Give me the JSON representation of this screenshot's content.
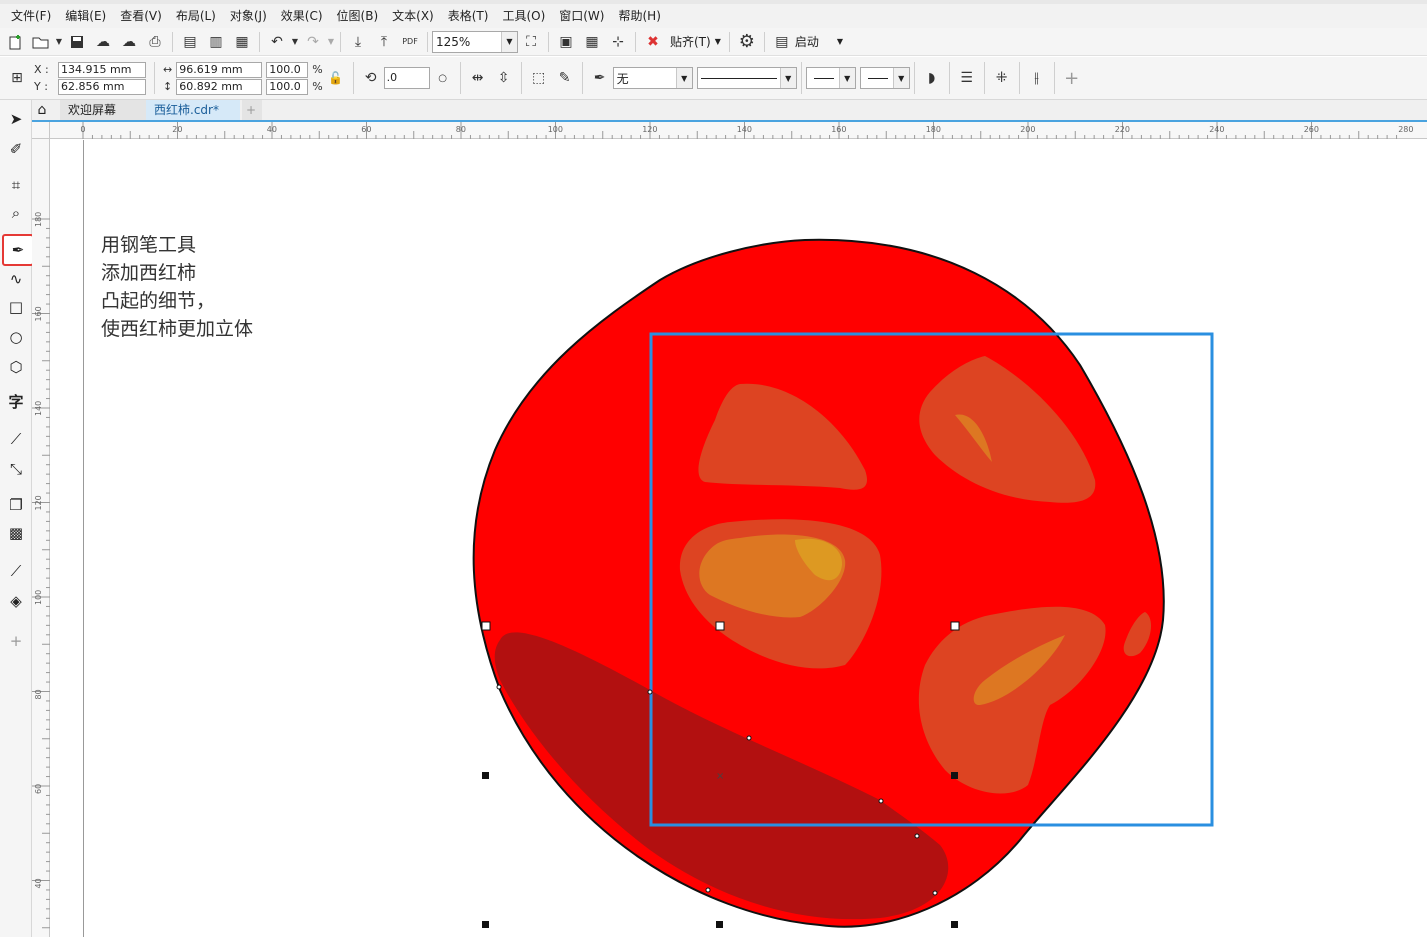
{
  "menu": [
    "文件(F)",
    "编辑(E)",
    "查看(V)",
    "布局(L)",
    "对象(J)",
    "效果(C)",
    "位图(B)",
    "文本(X)",
    "表格(T)",
    "工具(O)",
    "窗口(W)",
    "帮助(H)"
  ],
  "toolbar": {
    "zoom": "125%",
    "snap_label": "贴齐(T)",
    "launch_label": "启动",
    "pdf_label": "PDF"
  },
  "props": {
    "x_label": "X :",
    "y_label": "Y :",
    "x_value": "134.915 mm",
    "y_value": "62.856 mm",
    "w_value": "96.619 mm",
    "h_value": "60.892 mm",
    "scale_x": "100.0",
    "scale_y": "100.0",
    "pct": "%",
    "rotation": ".0",
    "fill_none": "无"
  },
  "tabs": {
    "welcome": "欢迎屏幕",
    "document": "西红柿.cdr*",
    "add": "+"
  },
  "ruler": {
    "h_ticks": [
      "0",
      "20",
      "40",
      "60",
      "80",
      "100",
      "120",
      "140",
      "160",
      "180",
      "200",
      "220",
      "240",
      "260",
      "280"
    ],
    "v_ticks": [
      "180",
      "160",
      "140",
      "120",
      "100",
      "80",
      "60",
      "40"
    ]
  },
  "note_lines": [
    "用钢笔工具",
    "添加西红柿",
    "凸起的细节，",
    "使西红柿更加立体"
  ],
  "colors": {
    "tomato": "#ff0000",
    "shadow": "#b21010",
    "highlight": "#dd4422",
    "highlight_light": "#dd7722",
    "selection": "#2a8fe0",
    "active_tool_border": "#e53935"
  }
}
